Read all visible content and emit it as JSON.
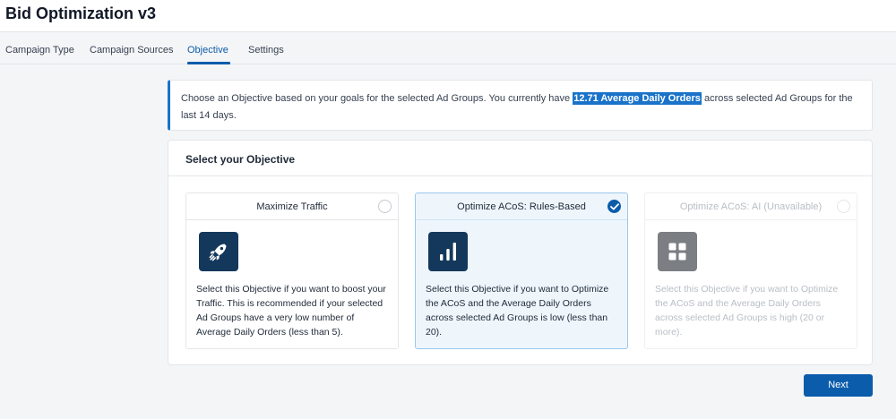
{
  "header": {
    "title": "Bid Optimization v3"
  },
  "tabs": [
    {
      "label": "Campaign Type"
    },
    {
      "label": "Campaign Sources"
    },
    {
      "label": "Objective",
      "active": true
    },
    {
      "label": "Settings"
    }
  ],
  "info": {
    "text_before": "Choose an Objective based on your goals for the selected Ad Groups. You currently have ",
    "highlight": "12.71 Average Daily Orders",
    "text_after": " across selected Ad Groups for the last 14 days."
  },
  "objective": {
    "heading": "Select your Objective",
    "options": [
      {
        "title": "Maximize Traffic",
        "icon": "rocket-icon",
        "description": "Select this Objective if you want to boost your Traffic. This is recommended if your selected Ad Groups have a very low number of Average Daily Orders (less than 5).",
        "selected": false,
        "disabled": false
      },
      {
        "title": "Optimize ACoS: Rules-Based",
        "icon": "bar-chart-icon",
        "description": "Select this Objective if you want to Optimize the ACoS and the Average Daily Orders across selected Ad Groups is low (less than 20).",
        "selected": true,
        "disabled": false
      },
      {
        "title": "Optimize ACoS: AI (Unavailable)",
        "icon": "grid-icon",
        "description": "Select this Objective if you want to Optimize the ACoS and the Average Daily Orders across selected Ad Groups is high (20 or more).",
        "selected": false,
        "disabled": true
      }
    ]
  },
  "actions": {
    "next_label": "Next"
  },
  "colors": {
    "accent": "#0b5cab",
    "icon_bg": "#14385c",
    "disabled_icon_bg": "#7b7f84",
    "selected_card_bg": "#eef6fc"
  }
}
